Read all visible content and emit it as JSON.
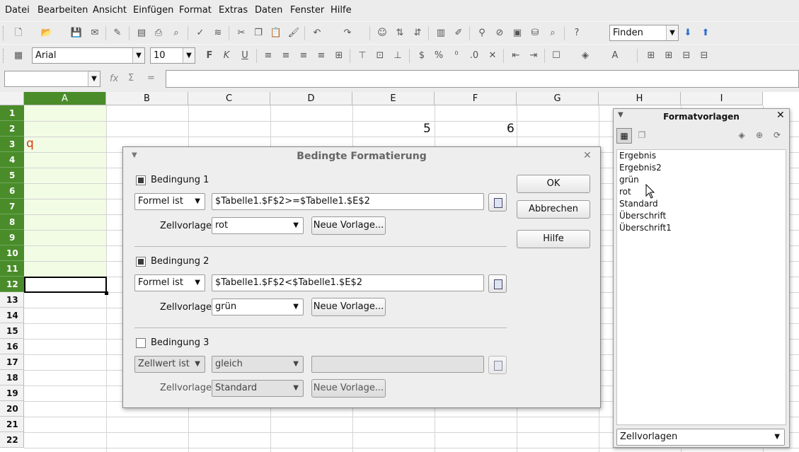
{
  "menu": [
    "Datei",
    "Bearbeiten",
    "Ansicht",
    "Einfügen",
    "Format",
    "Extras",
    "Daten",
    "Fenster",
    "Hilfe"
  ],
  "toolbar": {
    "find_value": "Finden",
    "font_name": "Arial",
    "font_size": "10"
  },
  "formula": {
    "name_box": "",
    "fx": "fx",
    "sum": "Σ",
    "eq": "=",
    "content": ""
  },
  "grid": {
    "columns": [
      "A",
      "B",
      "C",
      "D",
      "E",
      "F",
      "G",
      "H",
      "I"
    ],
    "rows": [
      "1",
      "2",
      "3",
      "4",
      "5",
      "6",
      "7",
      "8",
      "9",
      "10",
      "11",
      "12",
      "13",
      "14",
      "15",
      "16",
      "17",
      "18",
      "19",
      "20",
      "21",
      "22"
    ],
    "e2": "5",
    "f2": "6",
    "a3": "q"
  },
  "dialog": {
    "title": "Bedingte Formatierung",
    "cond1": {
      "label": "Bedingung 1",
      "type": "Formel ist",
      "formula": "$Tabelle1.$F$2>=$Tabelle1.$E$2",
      "style_label": "Zellvorlage",
      "style": "rot",
      "new_style": "Neue Vorlage..."
    },
    "cond2": {
      "label": "Bedingung 2",
      "type": "Formel ist",
      "formula": "$Tabelle1.$F$2<$Tabelle1.$E$2",
      "style_label": "Zellvorlage",
      "style": "grün",
      "new_style": "Neue Vorlage..."
    },
    "cond3": {
      "label": "Bedingung 3",
      "type": "Zellwert ist",
      "operator": "gleich",
      "value": "",
      "style_label": "Zellvorlage",
      "style": "Standard",
      "new_style": "Neue Vorlage..."
    },
    "ok": "OK",
    "cancel": "Abbrechen",
    "help": "Hilfe"
  },
  "panel": {
    "title": "Formatvorlagen",
    "styles": [
      "Ergebnis",
      "Ergebnis2",
      "grün",
      "rot",
      "Standard",
      "Überschrift",
      "Überschrift1"
    ],
    "filter": "Zellvorlagen"
  },
  "colors": {
    "accent_green": "#4a8c2a",
    "selected_col_fill": "#f2fbe4",
    "text_red": "#d04010"
  }
}
